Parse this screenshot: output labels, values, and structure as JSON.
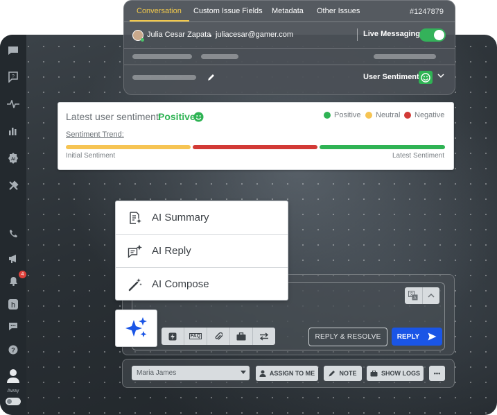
{
  "conversation": {
    "tabs": [
      {
        "label": "Conversation",
        "active": true
      },
      {
        "label": "Custom Issue Fields"
      },
      {
        "label": "Metadata"
      },
      {
        "label": "Other Issues"
      }
    ],
    "ticket_id": "#1247879",
    "user_name": "Julia Cesar Zapata",
    "user_email": "juliacesar@gamer.com",
    "live_messaging_label": "Live Messaging",
    "live_messaging_on": true,
    "user_sentiment_label": "User Sentiment"
  },
  "sentiment": {
    "title": "Latest user sentiment:",
    "value": "Positive",
    "legend": [
      {
        "label": "Positive",
        "color": "#2fb354"
      },
      {
        "label": "Neutral",
        "color": "#f6c453"
      },
      {
        "label": "Negative",
        "color": "#d23a36"
      }
    ],
    "trend_label": "Sentiment Trend:",
    "trend_segments": [
      {
        "sentiment": "Neutral",
        "color": "#f6c453"
      },
      {
        "sentiment": "Negative",
        "color": "#d23a36"
      },
      {
        "sentiment": "Positive",
        "color": "#2fb354"
      }
    ],
    "initial_label": "Initial Sentiment",
    "latest_label": "Latest Sentiment"
  },
  "ai_menu": {
    "items": [
      {
        "label": "AI Summary",
        "icon": "ai-summary-icon"
      },
      {
        "label": "AI Reply",
        "icon": "ai-reply-icon"
      },
      {
        "label": "AI Compose",
        "icon": "magic-wand-icon"
      }
    ]
  },
  "composer": {
    "toolbar_icons": [
      "lightning-icon",
      "faq-icon",
      "paperclip-icon",
      "briefcase-icon",
      "swap-icon"
    ],
    "faq_label": "FAQ",
    "reply_resolve_label": "REPLY & RESOLVE",
    "reply_label": "REPLY"
  },
  "footer": {
    "agent": "Maria James",
    "assign_label": "ASSIGN TO ME",
    "note_label": "NOTE",
    "logs_label": "SHOW LOGS",
    "more_label": "•••"
  },
  "sidebar": {
    "notification_count": "4",
    "away_label": "Away"
  },
  "colors": {
    "accent_tab": "#f2c94c",
    "reply_button": "#1a55e6",
    "toggle_on": "#34b25a"
  }
}
